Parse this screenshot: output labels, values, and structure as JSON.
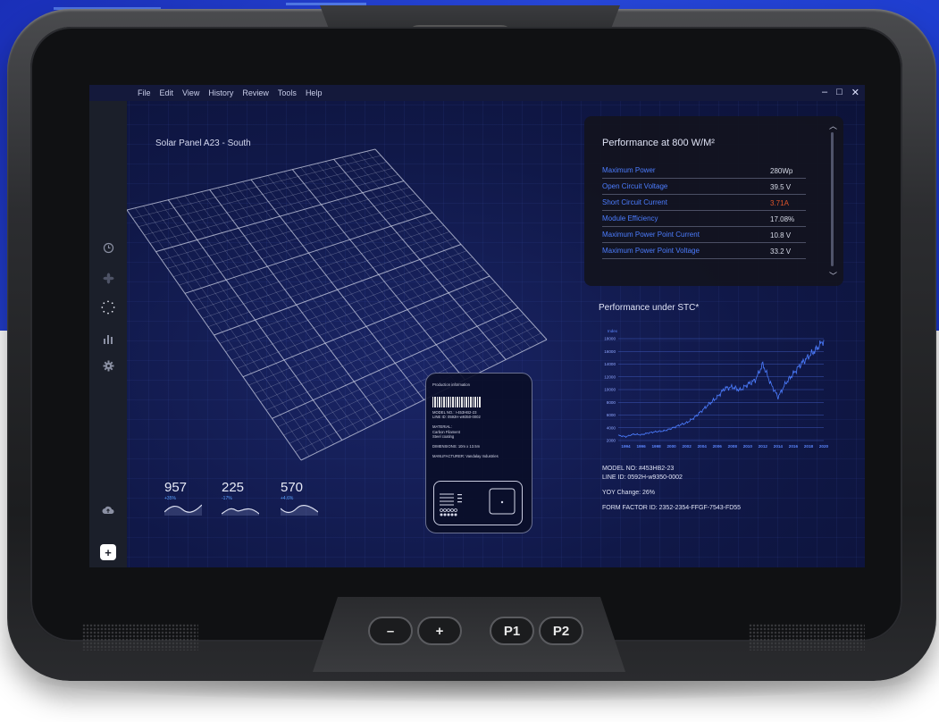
{
  "menu": [
    "File",
    "Edit",
    "View",
    "History",
    "Review",
    "Tools",
    "Help"
  ],
  "window_controls": {
    "minimize": "–",
    "maximize": "□",
    "close": "✕"
  },
  "sidebar": {
    "icons": [
      "clock-icon",
      "fan-icon",
      "loading-spinner-icon",
      "bar-chart-icon",
      "gear-icon"
    ],
    "bottom_icons": [
      "cloud-upload-icon"
    ],
    "add_label": "+"
  },
  "panel_title": "Solar Panel A23 - South",
  "metrics": [
    {
      "value": "957",
      "delta": "+35%"
    },
    {
      "value": "225",
      "delta": "-17%"
    },
    {
      "value": "570",
      "delta": "+4.6%"
    }
  ],
  "production": {
    "heading": "Production information",
    "model_line": "MODEL NO.: I-453HB2-23",
    "line_id": "LINE ID: 0592H-w9350-0002",
    "material_label": "MATERIAL:",
    "material_1": "Carbon Filament",
    "material_2": "Steel coating",
    "dimensions": "DIMENSIONS: 10m x 13.5m",
    "manufacturer": "MANUFACTURER: Vandalay Industries"
  },
  "performance": {
    "title": "Performance at 800 W/M²",
    "rows": [
      {
        "label": "Maximum Power",
        "value": "280Wp",
        "highlight": false
      },
      {
        "label": "Open Circuit Voltage",
        "value": "39.5 V",
        "highlight": false
      },
      {
        "label": "Short Circuit Current",
        "value": "3.71A",
        "highlight": true
      },
      {
        "label": "Module Efficiency",
        "value": "17.08%",
        "highlight": false
      },
      {
        "label": "Maximum Power Point Current",
        "value": "10.8 V",
        "highlight": false
      },
      {
        "label": "Maximum Power Point Voltage",
        "value": "33.2 V",
        "highlight": false
      }
    ],
    "highlight_color": "#e0552b",
    "label_color": "#4c7dff"
  },
  "stc_title": "Performance under STC*",
  "info": {
    "model": "MODEL NO: #453HB2-23",
    "line": "LINE ID: 0592H-w9350-0002",
    "yoy": "YOY Change: 26%",
    "form_factor": "FORM FACTOR ID: 2352-2354-FFGF-7543-FD55"
  },
  "hardware_buttons": [
    "–",
    "+",
    "P1",
    "P2"
  ],
  "chart_data": {
    "type": "line",
    "ylabel": "Index",
    "ylim": [
      2000,
      18000
    ],
    "yticks": [
      2000,
      4000,
      6000,
      8000,
      10000,
      12000,
      14000,
      16000,
      18000
    ],
    "xticks": [
      1994,
      1996,
      1998,
      2000,
      2002,
      2004,
      2006,
      2008,
      2010,
      2012,
      2014,
      2016,
      2018,
      2020
    ],
    "xlim": [
      1993,
      2020
    ],
    "series": [
      {
        "color": "#4c7dff",
        "x": [
          1993,
          1994,
          1995,
          1996,
          1997,
          1998,
          1999,
          2000,
          2001,
          2002,
          2003,
          2004,
          2005,
          2006,
          2007,
          2008,
          2009,
          2010,
          2011,
          2012,
          2013,
          2014,
          2015,
          2016,
          2017,
          2018,
          2019,
          2020
        ],
        "y": [
          2800,
          2600,
          3000,
          2900,
          3200,
          3400,
          3500,
          3900,
          4400,
          4800,
          5600,
          6700,
          7800,
          8800,
          10200,
          10400,
          9900,
          10800,
          11500,
          14000,
          11000,
          8800,
          11000,
          12500,
          14000,
          15200,
          16300,
          17800
        ]
      }
    ]
  }
}
